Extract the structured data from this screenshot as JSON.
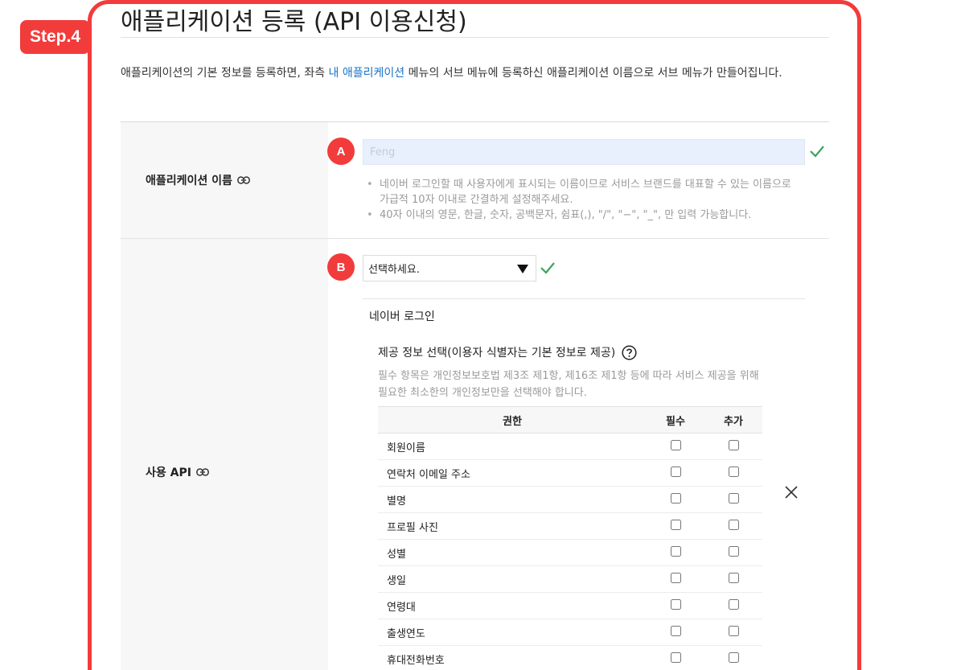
{
  "step_badge": "Step.4",
  "page": {
    "title": "애플리케이션 등록 (API 이용신청)",
    "intro_before": "애플리케이션의 기본 정보를 등록하면, 좌측 ",
    "intro_link": "내 애플리케이션",
    "intro_after": " 메뉴의 서브 메뉴에 등록하신 애플리케이션 이름으로 서브 메뉴가 만들어집니다."
  },
  "markers": {
    "a": "A",
    "b": "B"
  },
  "app_name": {
    "label": "애플리케이션 이름",
    "value": "Feng",
    "hints": [
      "네이버 로그인할 때 사용자에게 표시되는 이름이므로 서비스 브랜드를 대표할 수 있는 이름으로 가급적 10자 이내로 간결하게 설정해주세요.",
      "40자 이내의 영문, 한글, 숫자, 공백문자, 쉼표(,), \"/\", \"−\", \"_\", 만 입력 가능합니다."
    ]
  },
  "api": {
    "label": "사용 API",
    "select_value": "선택하세요.",
    "selected_api": "네이버 로그인",
    "info_title": "제공 정보 선택(이용자 식별자는 기본 정보로 제공)",
    "info_desc": "필수 항목은 개인정보보호법 제3조 제1항, 제16조 제1항 등에 따라 서비스 제공을 위해 필요한 최소한의 개인정보만을 선택해야 합니다.",
    "table": {
      "headers": [
        "권한",
        "필수",
        "추가"
      ],
      "rows": [
        "회원이름",
        "연락처 이메일 주소",
        "별명",
        "프로필 사진",
        "성별",
        "생일",
        "연령대",
        "출생연도",
        "휴대전화번호"
      ]
    }
  },
  "colors": {
    "accent_red": "#f23b3b",
    "link_blue": "#1a73c8",
    "check_green": "#3aa55a"
  }
}
